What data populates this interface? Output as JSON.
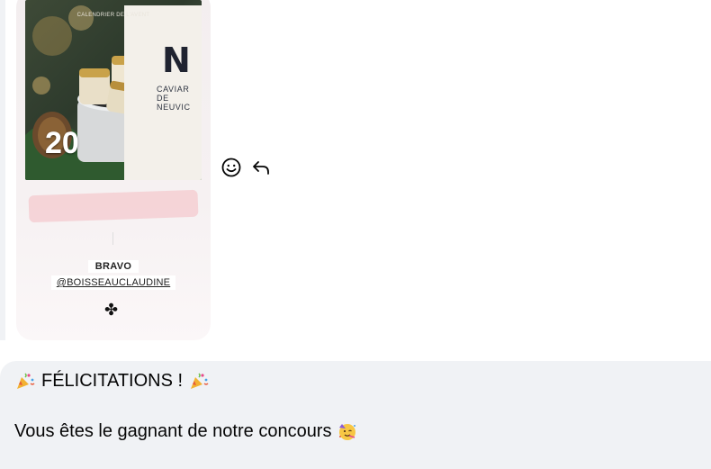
{
  "story": {
    "top_label": "CALENDRIER DE L'AVENT",
    "brand_mark": "N",
    "brand_line1": "CAVIAR",
    "brand_line2": "DE NEUVIC",
    "day_number": "20",
    "sticker_title": "BRAVO",
    "sticker_handle": "@BOISSEAUCLAUDINE",
    "clover_glyph": "✤"
  },
  "reactions": {
    "react_icon": "smiley-icon",
    "reply_icon": "reply-arrow-icon"
  },
  "message": {
    "line1_text": "FÉLICITATIONS !",
    "line2_text": "Vous êtes le gagnant de notre concours"
  },
  "colors": {
    "bubble_bg": "#f0f2f5",
    "highlight_pink": "#f5cfd2",
    "text": "#050505"
  }
}
